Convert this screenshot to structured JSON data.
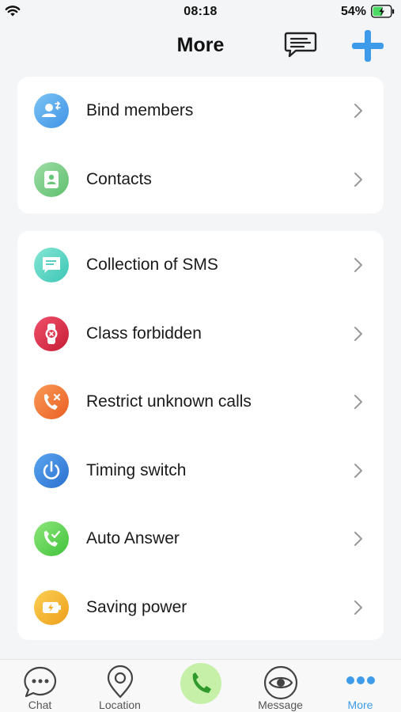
{
  "status_bar": {
    "time": "08:18",
    "battery_percent": "54%"
  },
  "header": {
    "title": "More",
    "message_icon": "message-icon",
    "add_icon": "plus-icon"
  },
  "group1": [
    {
      "label": "Bind members",
      "icon": "bind-members-icon",
      "color": "#5aaeee"
    },
    {
      "label": "Contacts",
      "icon": "contacts-icon",
      "color": "#7ccf8a"
    }
  ],
  "group2": [
    {
      "label": "Collection of SMS",
      "icon": "sms-icon",
      "color": "#5dd6c4"
    },
    {
      "label": "Class forbidden",
      "icon": "watch-forbidden-icon",
      "color": "#e0304a"
    },
    {
      "label": "Restrict unknown calls",
      "icon": "phone-block-icon",
      "color": "#f27a3c"
    },
    {
      "label": "Timing switch",
      "icon": "power-icon",
      "color": "#3a86e0"
    },
    {
      "label": "Auto Answer",
      "icon": "phone-check-icon",
      "color": "#5fd354"
    },
    {
      "label": "Saving power",
      "icon": "battery-saving-icon",
      "color": "#f4b632"
    }
  ],
  "tabs": [
    {
      "label": "Chat",
      "icon": "chat-icon"
    },
    {
      "label": "Location",
      "icon": "location-icon"
    },
    {
      "label": "",
      "icon": "phone-call-icon"
    },
    {
      "label": "Message",
      "icon": "eye-icon"
    },
    {
      "label": "More",
      "icon": "more-dots-icon",
      "active": true
    }
  ],
  "colors": {
    "accent": "#3d9be9",
    "background": "#f4f5f7",
    "card": "#ffffff"
  }
}
